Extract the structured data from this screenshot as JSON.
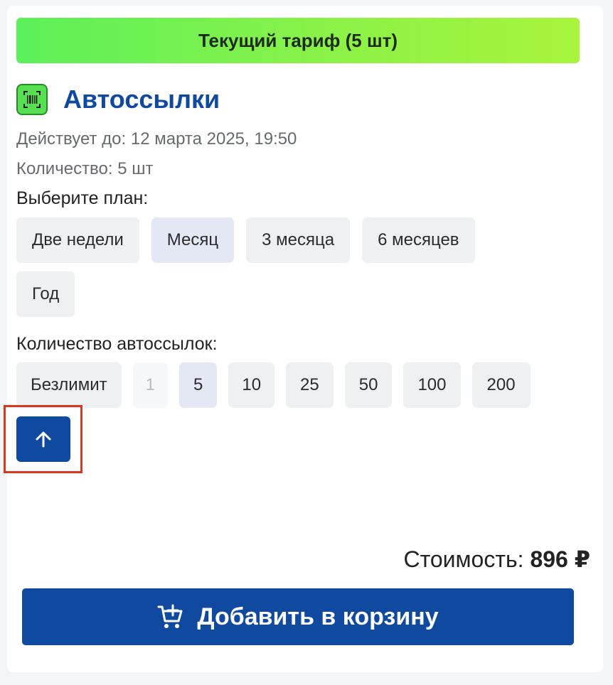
{
  "banner": {
    "text": "Текущий тариф (5 шт)"
  },
  "product": {
    "icon": "barcode-scan-icon",
    "title": "Автоссылки",
    "valid_until": "Действует до: 12 марта 2025, 19:50",
    "quantity": "Количество: 5 шт"
  },
  "plan": {
    "label": "Выберите план:",
    "options": [
      "Две недели",
      "Месяц",
      "3 месяца",
      "6 месяцев",
      "Год"
    ],
    "selected": "Месяц"
  },
  "count": {
    "label": "Количество автоссылок:",
    "options": [
      "Безлимит",
      "1",
      "5",
      "10",
      "25",
      "50",
      "100",
      "200"
    ],
    "selected": "5",
    "disabled": "1"
  },
  "up_button": {
    "icon": "arrow-up-icon"
  },
  "price": {
    "label": "Стоимость:",
    "value": "896 ₽"
  },
  "cart_button": {
    "icon": "cart-plus-icon",
    "label": "Добавить в корзину"
  },
  "colors": {
    "brand": "#0f4aa0",
    "banner_start": "#5cf05a",
    "banner_end": "#a8f43c",
    "highlight": "#d9381e"
  }
}
